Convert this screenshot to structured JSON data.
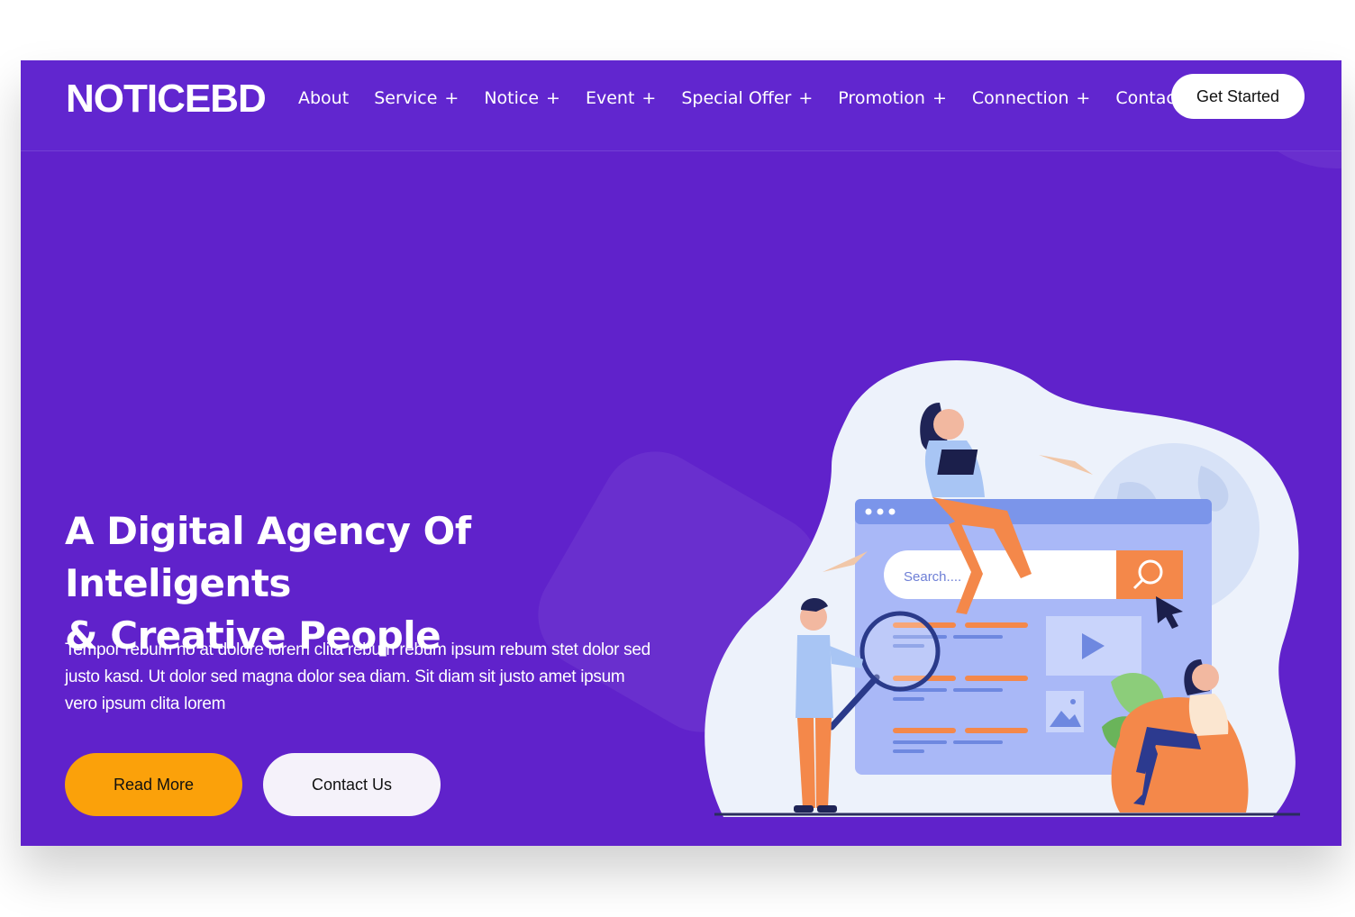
{
  "brand": "NOTICEBD",
  "nav": {
    "items": [
      {
        "label": "About",
        "has_submenu": false
      },
      {
        "label": "Service",
        "has_submenu": true
      },
      {
        "label": "Notice",
        "has_submenu": true
      },
      {
        "label": "Event",
        "has_submenu": true
      },
      {
        "label": "Special Offer",
        "has_submenu": true
      },
      {
        "label": "Promotion",
        "has_submenu": true
      },
      {
        "label": "Connection",
        "has_submenu": true
      },
      {
        "label": "Contact",
        "has_submenu": false
      }
    ],
    "submenu_marker": "+",
    "cta_label": "Get Started"
  },
  "hero": {
    "title_line1": "A Digital Agency Of Inteligents",
    "title_line2": "& Creative People",
    "text": "Tempor rebum no at dolore lorem clita rebum rebum ipsum rebum stet dolor sed justo kasd. Ut dolor sed magna dolor sea diam. Sit diam sit justo amet ipsum vero ipsum clita lorem",
    "primary_button": "Read More",
    "secondary_button": "Contact Us"
  },
  "illustration": {
    "search_placeholder": "Search....",
    "icons": [
      "search-icon",
      "play-icon",
      "image-icon",
      "cursor-icon"
    ]
  },
  "colors": {
    "background": "#6022cb",
    "accent": "#fba10a",
    "white": "#ffffff",
    "illustration_blue": "#a9b8f7",
    "illustration_orange": "#f4884a"
  }
}
